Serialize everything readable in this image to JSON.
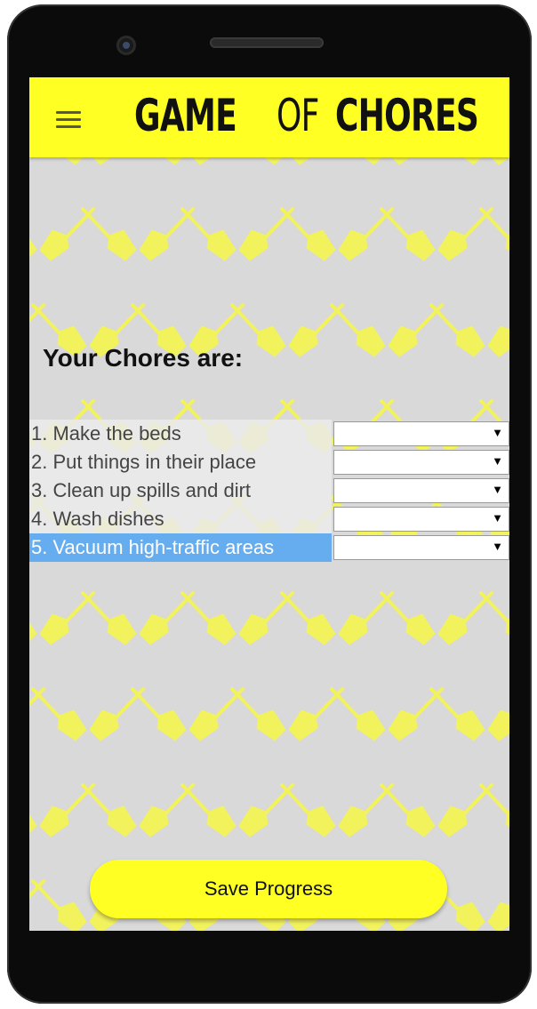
{
  "app": {
    "title_part1": "GAME ",
    "title_part2": "OF",
    "title_part3": " CHORES",
    "brand_color": "#ffff24",
    "background_color": "#d9d9d9",
    "pattern_icon": "broom-icon",
    "pattern_color": "#f2f25c"
  },
  "header": {
    "menu_icon": "hamburger-icon"
  },
  "main": {
    "heading": "Your Chores are:",
    "chores": [
      {
        "label": "1. Make the beds",
        "selected_value": ""
      },
      {
        "label": "2. Put things in their place",
        "selected_value": ""
      },
      {
        "label": "3. Clean up spills and dirt",
        "selected_value": ""
      },
      {
        "label": "4. Wash dishes",
        "selected_value": ""
      },
      {
        "label": "5. Vacuum high-traffic areas",
        "selected_value": "",
        "highlighted": true
      }
    ],
    "dropdown_arrow": "▼",
    "highlight_color": "#66adef"
  },
  "footer": {
    "save_label": "Save Progress"
  }
}
